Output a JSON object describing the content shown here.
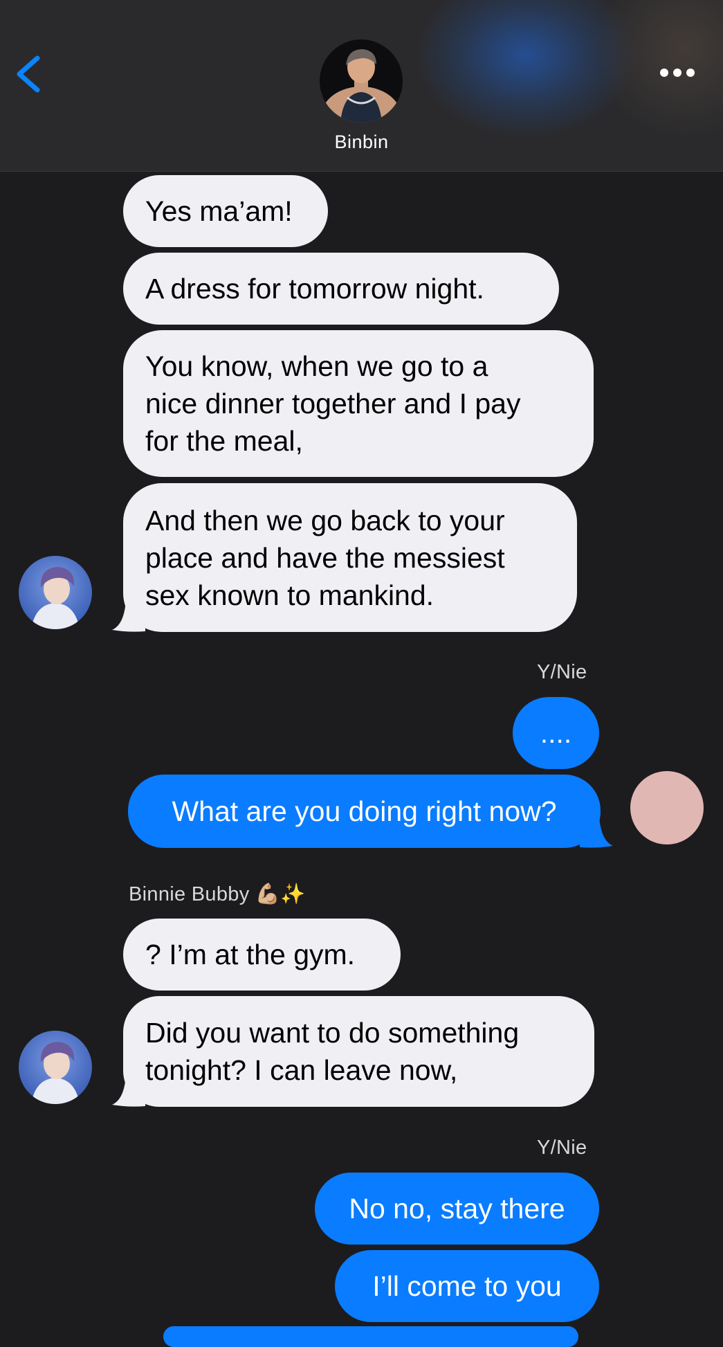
{
  "header": {
    "contact_name": "Binbin"
  },
  "icons": {
    "back": "chevron-left-icon",
    "more": "ellipsis-icon"
  },
  "colors": {
    "background": "#1c1c1e",
    "header": "#2a2a2c",
    "incoming_bubble": "#efeff4",
    "outgoing_bubble": "#0a7cff",
    "accent": "#0a84ff",
    "self_avatar": "#e0b7b3"
  },
  "messages": [
    {
      "from": "them",
      "text": "Yes ma’am!"
    },
    {
      "from": "them",
      "text": "A dress for tomorrow night."
    },
    {
      "from": "them",
      "text": "You know, when we go to a\nnice dinner together and I pay\nfor the meal,"
    },
    {
      "from": "them",
      "text": "And then we go back to your\nplace and have the messiest\nsex known to mankind."
    },
    {
      "from": "me",
      "sender": "Y/Nie",
      "text": "...."
    },
    {
      "from": "me",
      "text": "What are you doing right now?"
    },
    {
      "from": "them",
      "sender": "Binnie Bubby 💪🏼✨",
      "text": "? I’m at the gym."
    },
    {
      "from": "them",
      "text": "Did you want to do something\ntonight? I can leave now,"
    },
    {
      "from": "me",
      "sender": "Y/Nie",
      "text": "No no, stay there"
    },
    {
      "from": "me",
      "text": "I’ll come to you"
    }
  ]
}
